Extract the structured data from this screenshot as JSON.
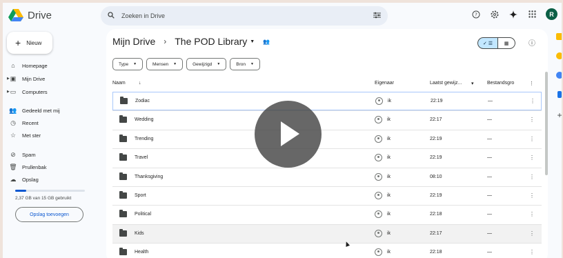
{
  "app": {
    "name": "Drive"
  },
  "search": {
    "placeholder": "Zoeken in Drive"
  },
  "header": {
    "avatar_letter": "R",
    "icons": [
      "help-icon",
      "settings-icon",
      "gemini-icon",
      "apps-icon"
    ]
  },
  "sidebar": {
    "new_label": "Nieuw",
    "items": [
      {
        "label": "Homepage",
        "icon": "home-icon"
      },
      {
        "label": "Mijn Drive",
        "icon": "drive-icon"
      },
      {
        "label": "Computers",
        "icon": "computer-icon"
      },
      {
        "label": "Gedeeld met mij",
        "icon": "people-icon"
      },
      {
        "label": "Recent",
        "icon": "clock-icon"
      },
      {
        "label": "Met ster",
        "icon": "star-icon"
      },
      {
        "label": "Spam",
        "icon": "spam-icon"
      },
      {
        "label": "Prullenbak",
        "icon": "trash-icon"
      },
      {
        "label": "Opslag",
        "icon": "cloud-icon"
      }
    ],
    "storage_text": "2,37 GB van 15 GB gebruikt",
    "storage_fraction": 0.158,
    "add_storage_label": "Opslag toevoegen"
  },
  "main": {
    "breadcrumb": {
      "root": "Mijn Drive",
      "current": "The POD Library"
    },
    "filters": [
      "Type",
      "Mensen",
      "Gewijzigd",
      "Bron"
    ],
    "columns": {
      "name": "Naam",
      "owner": "Eigenaar",
      "modified": "Laatst gewijz...",
      "size": "Bestandsgro"
    },
    "rows": [
      {
        "name": "Zodiac",
        "owner": "ik",
        "modified": "22:19",
        "size": "—"
      },
      {
        "name": "Wedding",
        "owner": "ik",
        "modified": "22:17",
        "size": "—"
      },
      {
        "name": "Trending",
        "owner": "ik",
        "modified": "22:19",
        "size": "—"
      },
      {
        "name": "Travel",
        "owner": "ik",
        "modified": "22:19",
        "size": "—"
      },
      {
        "name": "Thanksgiving",
        "owner": "ik",
        "modified": "08:10",
        "size": "—"
      },
      {
        "name": "Sport",
        "owner": "ik",
        "modified": "22:19",
        "size": "—"
      },
      {
        "name": "Political",
        "owner": "ik",
        "modified": "22:18",
        "size": "—"
      },
      {
        "name": "Kids",
        "owner": "ik",
        "modified": "22:17",
        "size": "—"
      },
      {
        "name": "Health",
        "owner": "ik",
        "modified": "22:18",
        "size": "—"
      }
    ]
  },
  "colors": {
    "accent": "#0b57d0",
    "selected_bg": "#c2e7ff",
    "avatar_bg": "#0b5f46"
  }
}
